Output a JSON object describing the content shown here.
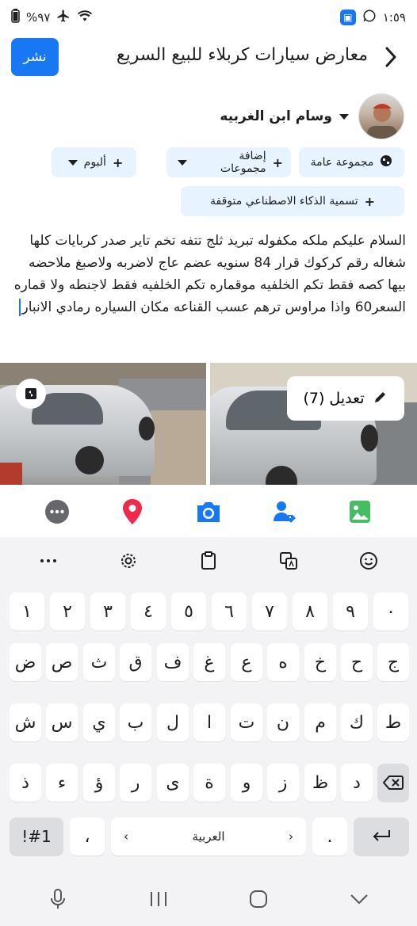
{
  "status_bar": {
    "time": "١:٥٩",
    "battery": "%٩٧"
  },
  "header": {
    "title": "معارض سيارات  كربلاء للبيع السريع",
    "publish_label": "نشر"
  },
  "user": {
    "name": "وسام ابن الغربيه"
  },
  "chips": {
    "audience": "مجموعة عامة",
    "add_groups": "إضافة مجموعات",
    "album": "ألبوم",
    "ai_label": "تسمية الذكاء الاصطناعي متوقفة"
  },
  "post": {
    "text": "السلام عليكم ملكه مكفوله تبريد ثلج تتفه تخم تاير صدر كربايات كلها شغاله رقم كركوك قرار 84 سنويه عضم عاج لاضربه ولاصبغ ملاحضه بيها كصه فقط تكم الخلفيه موقماره تكم الخلفيه فقط لاجنطه ولا قماره السعر60 واذا مراوس ترهم عسب القناعه مكان السياره رمادي الانبار"
  },
  "media": {
    "edit_label": "تعديل (7)"
  },
  "composer_tools": [
    "more-icon",
    "location-icon",
    "camera-icon",
    "tag-people-icon",
    "photo-icon"
  ],
  "keyboard": {
    "row_numbers": [
      "١",
      "٢",
      "٣",
      "٤",
      "٥",
      "٦",
      "٧",
      "٨",
      "٩",
      "٠"
    ],
    "row1": [
      "ض",
      "ص",
      "ث",
      "ق",
      "ف",
      "غ",
      "ع",
      "ه",
      "خ",
      "ح",
      "ج"
    ],
    "row2": [
      "ش",
      "س",
      "ي",
      "ب",
      "ل",
      "ا",
      "ت",
      "ن",
      "م",
      "ك",
      "ط"
    ],
    "row3": [
      "ذ",
      "ء",
      "ؤ",
      "ر",
      "ى",
      "ة",
      "و",
      "ز",
      "ظ",
      "د"
    ],
    "symbols_label": "!#1",
    "comma_label": "،",
    "space_label": "العربية",
    "period_label": "."
  },
  "colors": {
    "accent": "#1877f2",
    "chip_bg": "#e7f3ff",
    "location": "#f02849",
    "photo": "#45bd62"
  }
}
